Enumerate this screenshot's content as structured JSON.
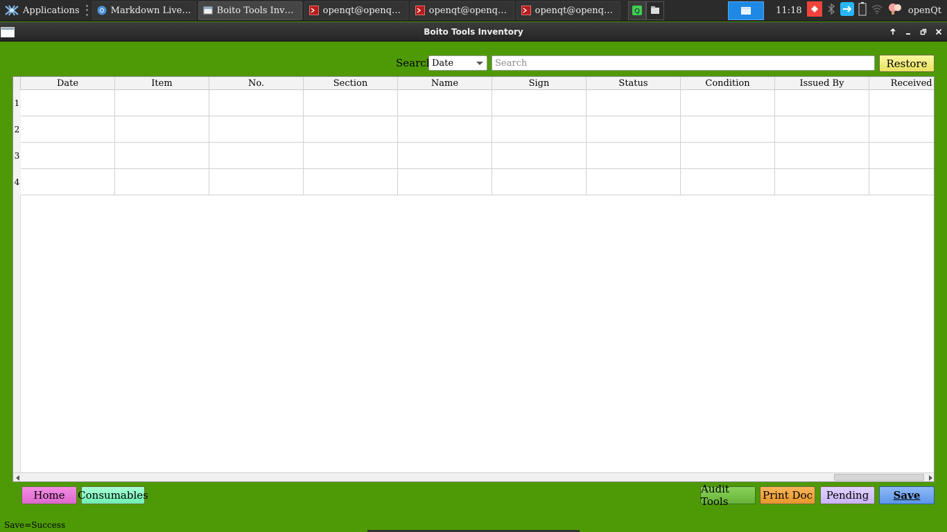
{
  "taskbar": {
    "applications_label": "Applications",
    "tasks": [
      {
        "label": "Markdown Live Pr…",
        "icon": "chromium-icon"
      },
      {
        "label": "Boito Tools Inventory",
        "icon": "window-icon"
      },
      {
        "label": "openqt@openqt: ~/…",
        "icon": "terminal-icon"
      },
      {
        "label": "openqt@openqt: ~",
        "icon": "terminal-icon"
      },
      {
        "label": "openqt@openqt: ~/…",
        "icon": "terminal-icon"
      }
    ],
    "clock": "11:18",
    "user": "openQt"
  },
  "window": {
    "title": "Boito Tools Inventory"
  },
  "search": {
    "label": "Search",
    "field_selected": "Date",
    "placeholder": "Search",
    "value": "",
    "restore_label": "Restore"
  },
  "table": {
    "columns": [
      "Date",
      "Item",
      "No.",
      "Section",
      "Name",
      "Sign",
      "Status",
      "Condition",
      "Issued By",
      "Received B"
    ],
    "row_numbers": [
      "1",
      "2",
      "3",
      "4"
    ]
  },
  "buttons": {
    "home": "Home",
    "consumables": "Consumables",
    "audit_tools": "Audit Tools",
    "print_doc": "Print Doc",
    "pending": "Pending",
    "save": "Save"
  },
  "status_bar": {
    "message": "Save=Success"
  },
  "colors": {
    "background": "#4e9a06",
    "restore": "#efe86f",
    "home": "#e97bda",
    "consumables": "#8cf8c3",
    "audit": "#78c248",
    "print": "#ef a543",
    "pending": "#d4c4fb",
    "save": "#75a8ef"
  }
}
